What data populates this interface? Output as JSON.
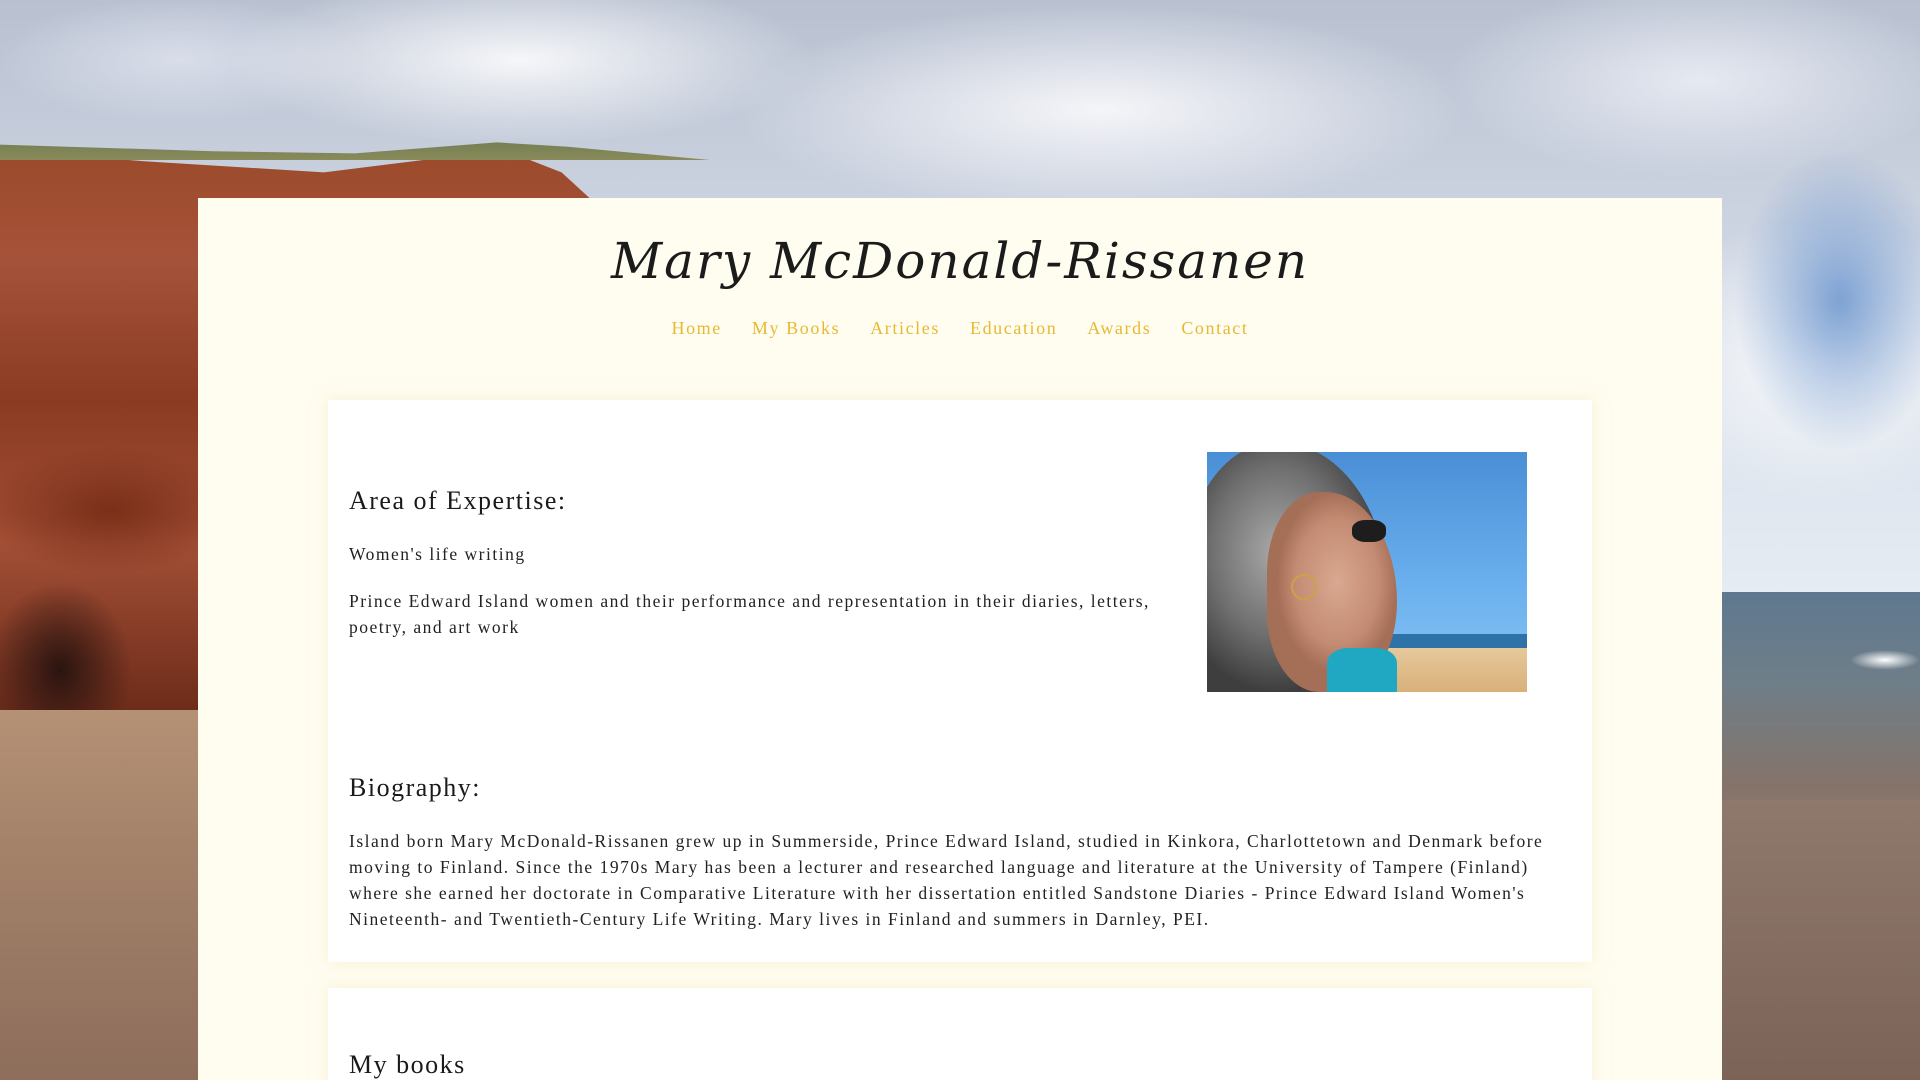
{
  "site": {
    "title": "Mary McDonald-Rissanen"
  },
  "nav": {
    "items": [
      "Home",
      "My Books",
      "Articles",
      "Education",
      "Awards",
      "Contact"
    ]
  },
  "expertise": {
    "heading": "Area of Expertise:",
    "item1": "Women's life writing",
    "item2": "Prince Edward Island women and their performance and representation in their diaries, letters, poetry, and art work"
  },
  "biography": {
    "heading": "Biography:",
    "text": "Island born Mary McDonald-Rissanen grew up in Summerside, Prince Edward Island, studied in Kinkora, Charlottetown and Denmark before moving to Finland. Since the 1970s Mary has been a lecturer and researched language and literature at the University of Tampere (Finland) where she earned her doctorate in Comparative Literature with her dissertation entitled Sandstone Diaries - Prince Edward Island Women's Nineteenth- and Twentieth-Century Life Writing. Mary lives in Finland and summers in Darnley, PEI."
  },
  "books": {
    "heading": "My books"
  },
  "colors": {
    "panel": "#fffdf0",
    "nav_link": "#e7b832",
    "text": "#1a1a1a"
  }
}
